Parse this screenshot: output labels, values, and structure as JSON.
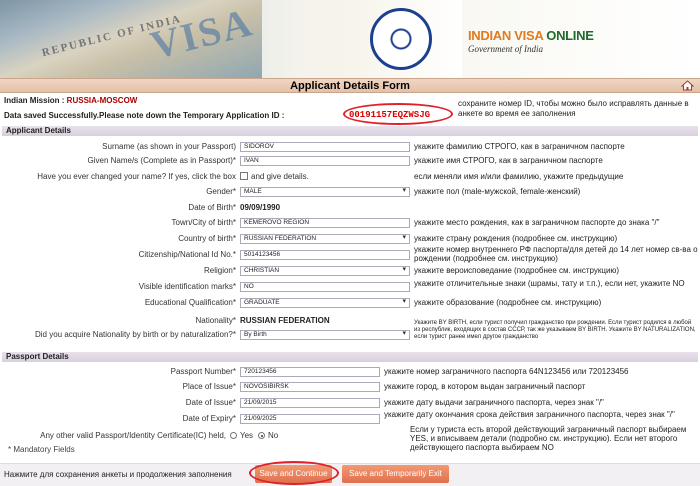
{
  "header": {
    "logo_main": "INDIAN VISA",
    "logo_online": "ONLINE",
    "logo_sub": "Government of India",
    "banner_visa_word": "VISA",
    "banner_visa_text": "REPUBLIC OF INDIA"
  },
  "form_title": "Applicant Details Form",
  "mission_label": "Indian Mission : ",
  "mission_value": "RUSSIA-MOSCOW",
  "saved_message": "Data saved Successfully.Please note down the Temporary Application ID :",
  "application_id": "00191157EQZWSJG",
  "id_note": "сохраните номер ID, чтобы можно было исправлять данные в анкете во время ее заполнения",
  "sections": {
    "applicant": "Applicant Details",
    "passport": "Passport Details"
  },
  "fields": {
    "surname": {
      "label": "Surname (as shown in your Passport)",
      "value": "SIDOROV",
      "note": "укажите фамилию СТРОГО, как в заграничном паспорте"
    },
    "given": {
      "label": "Given Name/s (Complete as in Passport)*",
      "value": "IVAN",
      "note": "укажите имя СТРОГО, как в заграничном паспорте"
    },
    "changed": {
      "label": "Have you ever changed your name? If yes, click the box",
      "after": "and give details.",
      "note": "если меняли имя и/или фамилию, укажите предыдущие"
    },
    "gender": {
      "label": "Gender*",
      "value": "MALE",
      "note": "укажите пол (male-мужской, female-женский)"
    },
    "dob": {
      "label": "Date of Birth*",
      "value": "09/09/1990"
    },
    "town": {
      "label": "Town/City of birth*",
      "value": "KEMEROVO REGION",
      "note": "укажите место рождения, как в заграничном паспорте до знака \"/\""
    },
    "country": {
      "label": "Country of birth*",
      "value": "RUSSIAN FEDERATION",
      "note": "укажите страну рождения (подробнее см. инструкцию)"
    },
    "citizenship": {
      "label": "Citizenship/National Id No.*",
      "value": "5014123456",
      "note": "укажите номер внутреннего РФ паспорта/для детей до 14 лет номер св-ва о рождении (подробнее см. инструкцию)"
    },
    "religion": {
      "label": "Religion*",
      "value": "CHRISTIAN",
      "note": "укажите вероисповедание (подробнее см. инструкцию)"
    },
    "marks": {
      "label": "Visible identification marks*",
      "value": "NO",
      "note": "укажите отличительные знаки (шрамы, тату и т.п.), если нет, укажите NO"
    },
    "education": {
      "label": "Educational Qualification*",
      "value": "GRADUATE",
      "note": "укажите образование (подробнее см. инструкцию)"
    },
    "nationality": {
      "label": "Nationality*",
      "value": "RUSSIAN FEDERATION"
    },
    "acquire": {
      "label": "Did you acquire Nationality by birth or by naturalization?*",
      "value": "By Birth",
      "note": "Укажите BY BIRTH, если турист получил гражданство при рождении. Если турист родился в любой из республик, входящих в состав СССР, так же указываем BY BIRTH. Укажите BY NATURALIZATION, если турист ранее имел другое гражданство"
    },
    "passport_no": {
      "label": "Passport Number*",
      "value": "720123456",
      "note": "укажите номер заграничного паспорта 64N123456 или 720123456"
    },
    "place_issue": {
      "label": "Place of Issue*",
      "value": "NOVOSIBIRSK",
      "note": "укажите город, в котором выдан заграничный паспорт"
    },
    "date_issue": {
      "label": "Date of Issue*",
      "value": "21/09/2015",
      "note": "укажите дату выдачи заграничного паспорта, через знак \"/\""
    },
    "date_expiry": {
      "label": "Date of Expiry*",
      "value": "21/09/2025",
      "note": "укажите дату окончания срока действия заграничного паспорта, через знак \"/\""
    },
    "other_passport": {
      "label": "Any other valid Passport/Identity Certificate(IC) held,",
      "yes": "Yes",
      "no": "No",
      "note": "Если у туриста есть второй действующий заграничный паспорт выбираем YES, и вписываем детали (подробно см. инструкцию). Если нет второго действующего паспорта выбираем NO"
    }
  },
  "mandatory": "* Mandatory Fields",
  "footer_note": "Нажмите для сохранения анкеты и продолжения заполнения",
  "buttons": {
    "save_continue": "Save and Continue",
    "save_exit": "Save and Temporarily Exit"
  }
}
